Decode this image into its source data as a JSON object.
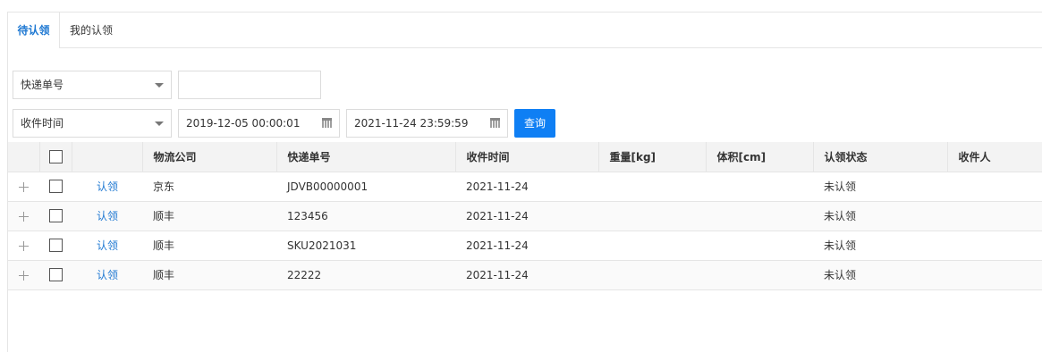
{
  "tabs": [
    {
      "label": "待认领"
    },
    {
      "label": "我的认领"
    }
  ],
  "filters": {
    "search_field": "快递单号",
    "search_value": "",
    "time_field": "收件时间",
    "start_time": "2019-12-05 00:00:01",
    "end_time": "2021-11-24 23:59:59",
    "query_label": "查询"
  },
  "table": {
    "headers": [
      "物流公司",
      "快递单号",
      "收件时间",
      "重量[kg]",
      "体积[cm]",
      "认领状态",
      "收件人"
    ],
    "rows": [
      {
        "action": "认领",
        "company": "京东",
        "tracking": "JDVB00000001",
        "time": "2021-11-24",
        "weight": "",
        "volume": "",
        "status": "未认领",
        "recipient": ""
      },
      {
        "action": "认领",
        "company": "顺丰",
        "tracking": "123456",
        "time": "2021-11-24",
        "weight": "",
        "volume": "",
        "status": "未认领",
        "recipient": ""
      },
      {
        "action": "认领",
        "company": "顺丰",
        "tracking": "SKU2021031",
        "time": "2021-11-24",
        "weight": "",
        "volume": "",
        "status": "未认领",
        "recipient": ""
      },
      {
        "action": "认领",
        "company": "顺丰",
        "tracking": "22222",
        "time": "2021-11-24",
        "weight": "",
        "volume": "",
        "status": "未认领",
        "recipient": ""
      }
    ]
  }
}
